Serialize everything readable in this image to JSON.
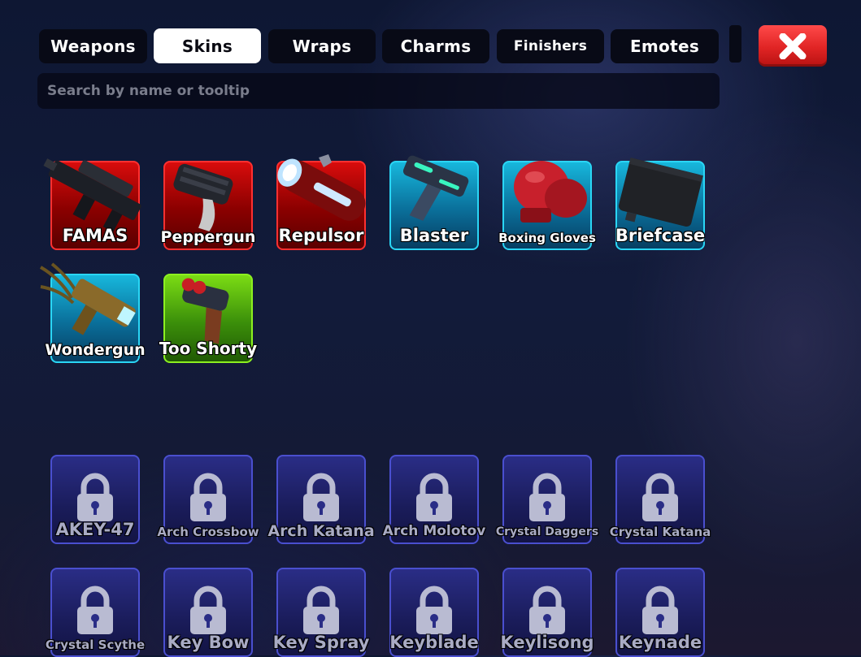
{
  "tabs": [
    {
      "label": "Weapons",
      "active": false
    },
    {
      "label": "Skins",
      "active": true
    },
    {
      "label": "Wraps",
      "active": false
    },
    {
      "label": "Charms",
      "active": false
    },
    {
      "label": "Finishers",
      "active": false
    },
    {
      "label": "Emotes",
      "active": false
    }
  ],
  "close_icon": "close-x-icon",
  "search": {
    "placeholder": "Search by name or tooltip",
    "value": ""
  },
  "owned": [
    {
      "name": "FAMAS",
      "rarity": "red",
      "icon": "famas-rifle-icon"
    },
    {
      "name": "Peppergun",
      "rarity": "red",
      "icon": "peppergun-icon"
    },
    {
      "name": "Repulsor",
      "rarity": "red",
      "icon": "repulsor-gauntlet-icon"
    },
    {
      "name": "Blaster",
      "rarity": "cyan",
      "icon": "blaster-pistol-icon"
    },
    {
      "name": "Boxing Gloves",
      "rarity": "cyan",
      "icon": "boxing-gloves-icon"
    },
    {
      "name": "Briefcase",
      "rarity": "cyan",
      "icon": "briefcase-icon"
    },
    {
      "name": "Wondergun",
      "rarity": "cyan",
      "icon": "wondergun-icon"
    },
    {
      "name": "Too Shorty",
      "rarity": "green",
      "icon": "too-shorty-shotgun-icon"
    }
  ],
  "locked": [
    {
      "name": "AKEY-47"
    },
    {
      "name": "Arch Crossbow"
    },
    {
      "name": "Arch Katana"
    },
    {
      "name": "Arch Molotov"
    },
    {
      "name": "Crystal Daggers"
    },
    {
      "name": "Crystal Katana"
    },
    {
      "name": "Crystal Scythe"
    },
    {
      "name": "Key Bow"
    },
    {
      "name": "Key Spray"
    },
    {
      "name": "Keyblade"
    },
    {
      "name": "Keylisong"
    },
    {
      "name": "Keynade"
    }
  ],
  "colors": {
    "red": "#d80c0c",
    "cyan": "#17b7dc",
    "green": "#7bdc14",
    "locked": "#2a2d86",
    "close": "#e02424"
  }
}
